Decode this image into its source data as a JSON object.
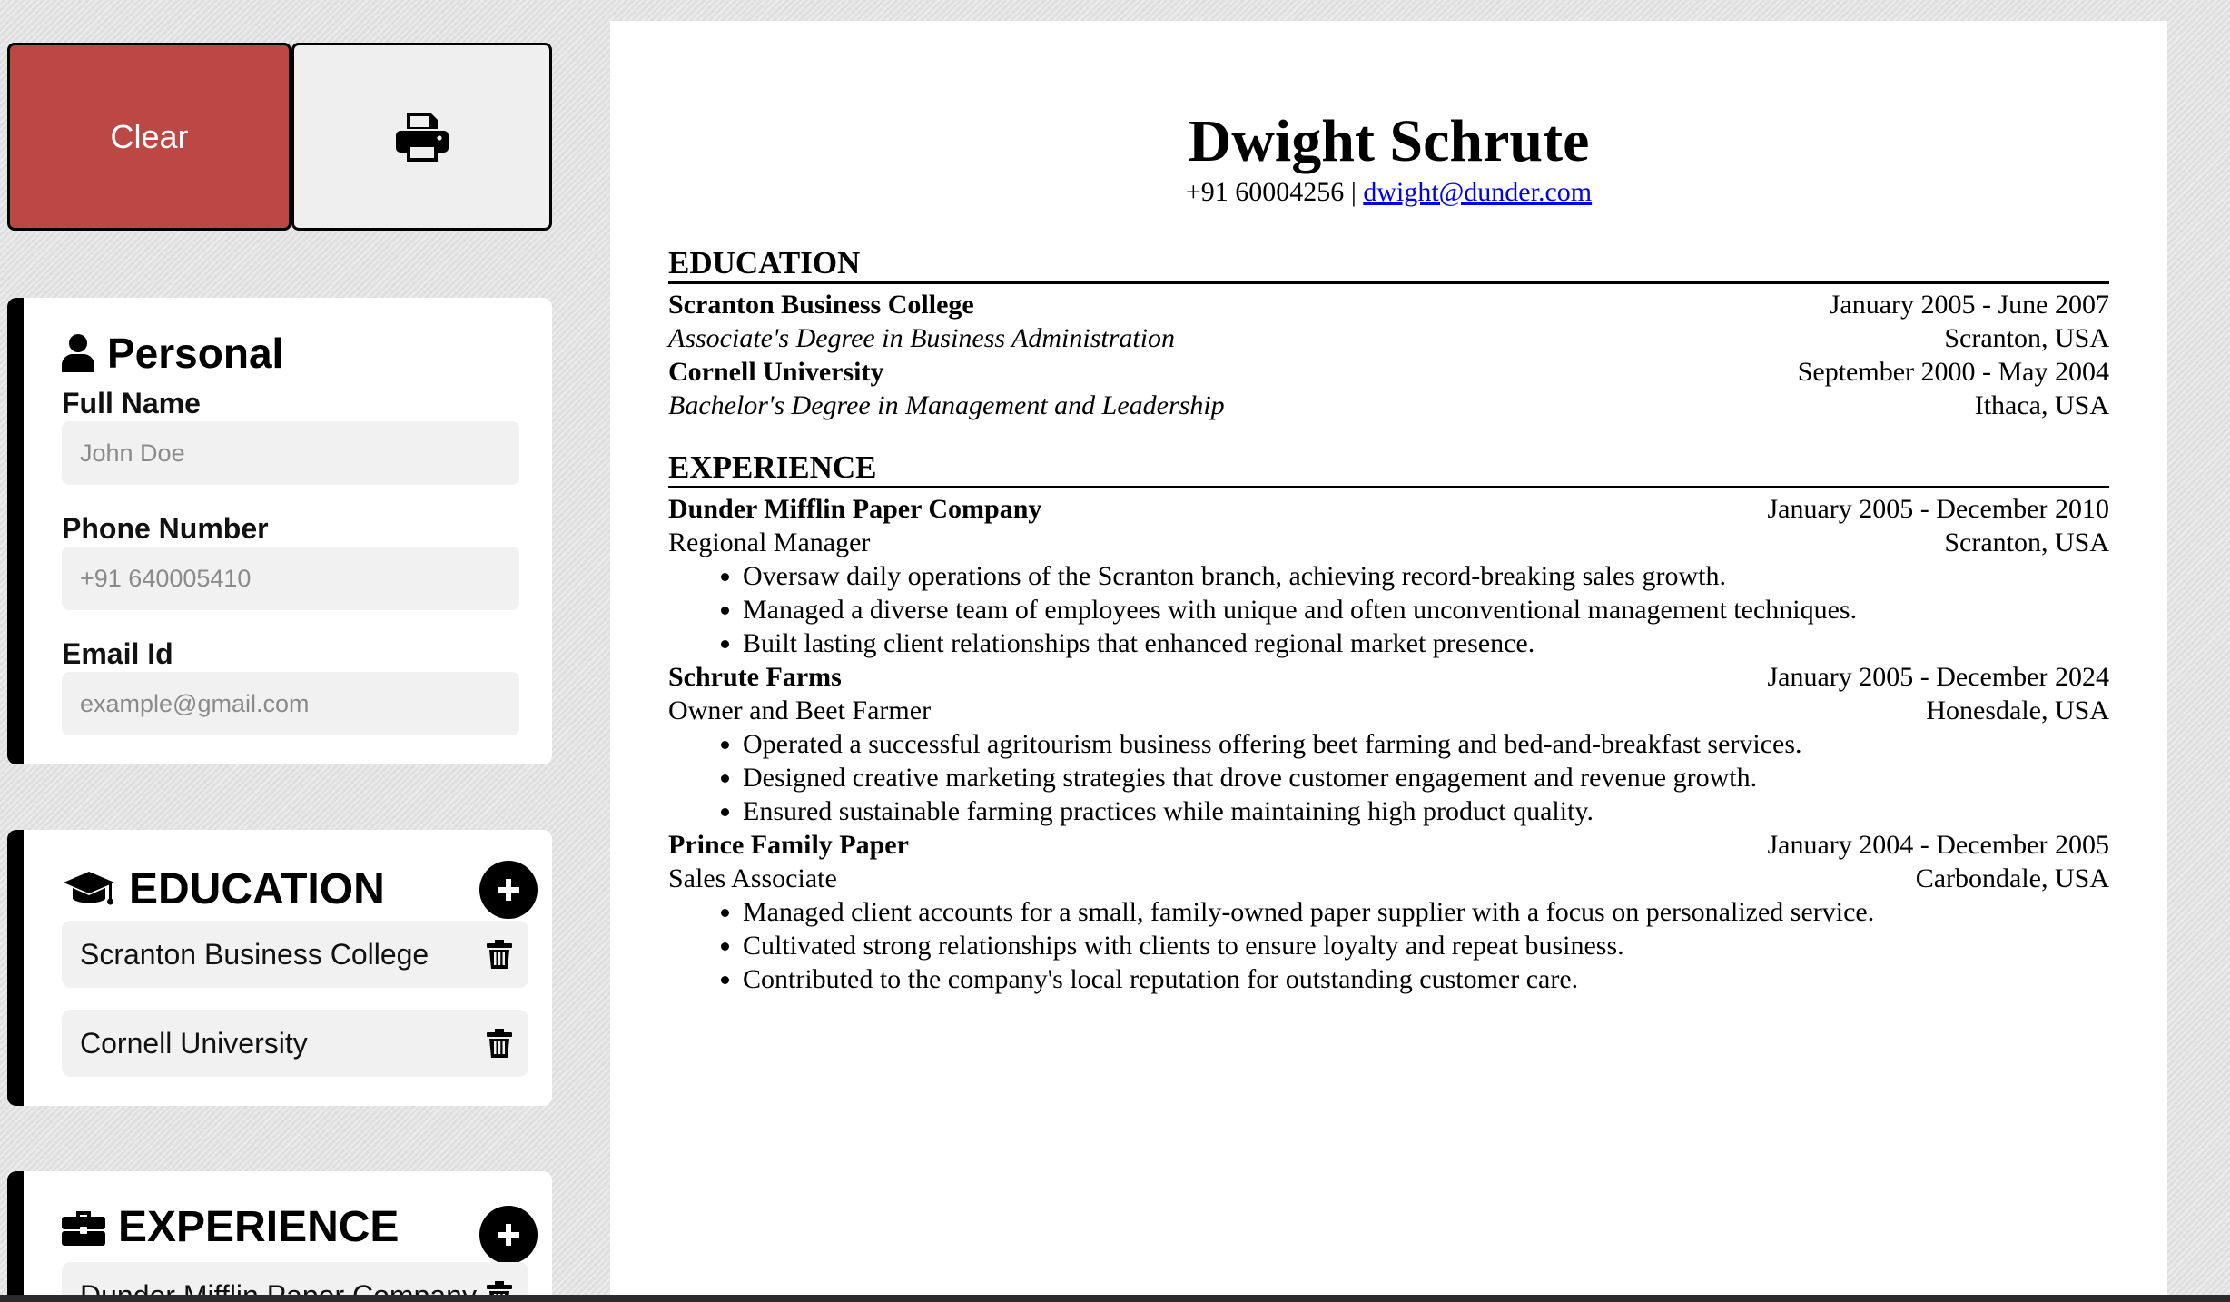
{
  "toolbar": {
    "clear_label": "Clear",
    "print_icon": "printer-icon"
  },
  "personal": {
    "title": "Personal",
    "icon": "user-icon",
    "full_name_label": "Full Name",
    "full_name_placeholder": "John Doe",
    "phone_label": "Phone Number",
    "phone_placeholder": "+91 640005410",
    "email_label": "Email Id",
    "email_placeholder": "example@gmail.com"
  },
  "education_panel": {
    "title": "EDUCATION",
    "icon": "graduation-cap-icon",
    "items": [
      {
        "label": "Scranton Business College"
      },
      {
        "label": "Cornell University"
      }
    ]
  },
  "experience_panel": {
    "title": "EXPERIENCE",
    "icon": "briefcase-icon",
    "items": [
      {
        "label": "Dunder Mifflin Paper Company"
      }
    ]
  },
  "resume": {
    "name": "Dwight Schrute",
    "phone": "+91 60004256",
    "separator": "|",
    "email": "dwight@dunder.com",
    "education_heading": "EDUCATION",
    "education": [
      {
        "school": "Scranton Business College",
        "dates": "January 2005 - June 2007",
        "degree": "Associate's Degree in Business Administration",
        "location": "Scranton, USA"
      },
      {
        "school": "Cornell University",
        "dates": "September 2000 - May 2004",
        "degree": "Bachelor's Degree in Management and Leadership",
        "location": "Ithaca, USA"
      }
    ],
    "experience_heading": "EXPERIENCE",
    "experience": [
      {
        "company": "Dunder Mifflin Paper Company",
        "dates": "January 2005 - December 2010",
        "role": "Regional Manager",
        "location": "Scranton, USA",
        "bullets": [
          "Oversaw daily operations of the Scranton branch, achieving record-breaking sales growth.",
          "Managed a diverse team of employees with unique and often unconventional management techniques.",
          "Built lasting client relationships that enhanced regional market presence."
        ]
      },
      {
        "company": "Schrute Farms",
        "dates": "January 2005 - December 2024",
        "role": "Owner and Beet Farmer",
        "location": "Honesdale, USA",
        "bullets": [
          "Operated a successful agritourism business offering beet farming and bed-and-breakfast services.",
          "Designed creative marketing strategies that drove customer engagement and revenue growth.",
          "Ensured sustainable farming practices while maintaining high product quality."
        ]
      },
      {
        "company": "Prince Family Paper",
        "dates": "January 2004 - December 2005",
        "role": "Sales Associate",
        "location": "Carbondale, USA",
        "bullets": [
          "Managed client accounts for a small, family-owned paper supplier with a focus on personalized service.",
          "Cultivated strong relationships with clients to ensure loyalty and repeat business.",
          "Contributed to the company's local reputation for outstanding customer care."
        ]
      }
    ]
  }
}
